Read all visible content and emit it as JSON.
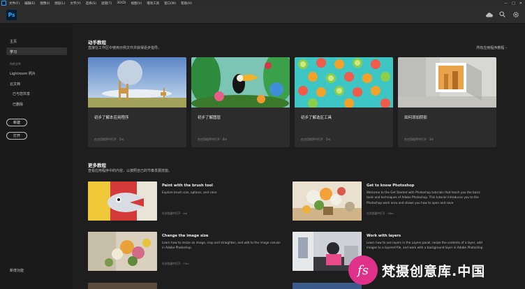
{
  "menubar": {
    "app_icon": "ps-icon",
    "items": [
      "文件(F)",
      "编辑(E)",
      "图像(I)",
      "图层(L)",
      "文字(Y)",
      "选择(S)",
      "滤镜(T)",
      "3D(D)",
      "视图(V)",
      "增效工具",
      "窗口(W)",
      "帮助(H)"
    ]
  },
  "topbar": {
    "logo": "Ps",
    "icons": [
      "cloud-icon",
      "search-icon",
      "settings-icon"
    ]
  },
  "sidebar": {
    "home": "主页",
    "learn": "学习",
    "your_files_heading": "你的文件",
    "lightroom": "Lightroom 照片",
    "cloud_docs": "云文档",
    "shared": "已与您共享",
    "deleted": "已删除",
    "new_button": "新建",
    "open_button": "打开",
    "whats_new": "新增功能"
  },
  "hands_on": {
    "title": "动手教程",
    "subtitle": "直接在工作区中使用示例文件并获得逐步指导。",
    "view_all": "所有应用程序教程",
    "cards": [
      {
        "title": "初步了解本应用程序",
        "meta": "在应用程序中打开 · 5m"
      },
      {
        "title": "初步了解图层",
        "meta": "在应用程序中打开 · 8m"
      },
      {
        "title": "初步了解选区工具",
        "meta": "在应用程序中打开 · 5m"
      },
      {
        "title": "如何添加阴影",
        "meta": "在应用程序中打开 · 3m"
      }
    ]
  },
  "more_tutorials": {
    "title": "更多教程",
    "subtitle": "查看应用程序中的内容，以按照自己的节奏发展技能。",
    "items": [
      {
        "title": "Paint with the brush tool",
        "desc": "Explore brush size, options, and color.",
        "meta": "在浏览器中打开 · 4m"
      },
      {
        "title": "Get to know Photoshop",
        "desc": "Welcome to the Get Started with Photoshop tutorials that teach you the basic tools and techniques of Adobe Photoshop. This tutorial introduces you to the Photoshop work area and shows you how to open and save",
        "meta": "在浏览器中打开 · 28m"
      },
      {
        "title": "Change the image size",
        "desc": "Learn how to resize an image, crop and straighten, and add to the image canvas in Adobe Photoshop.",
        "meta": "在浏览器中打开 · 13m"
      },
      {
        "title": "Work with layers",
        "desc": "Learn how to use layers in the Layers panel, resize the contents of a layer, add images to a layered file, and work with a background layer in Adobe Photoshop.",
        "meta": ""
      }
    ]
  },
  "watermark": {
    "logo": "fs",
    "text": "梵摄创意库.中国"
  },
  "colors": {
    "background": "#1e1e1e",
    "panel": "#2c2c2c",
    "accent": "#31a8ff",
    "watermark": "#e0318a"
  }
}
